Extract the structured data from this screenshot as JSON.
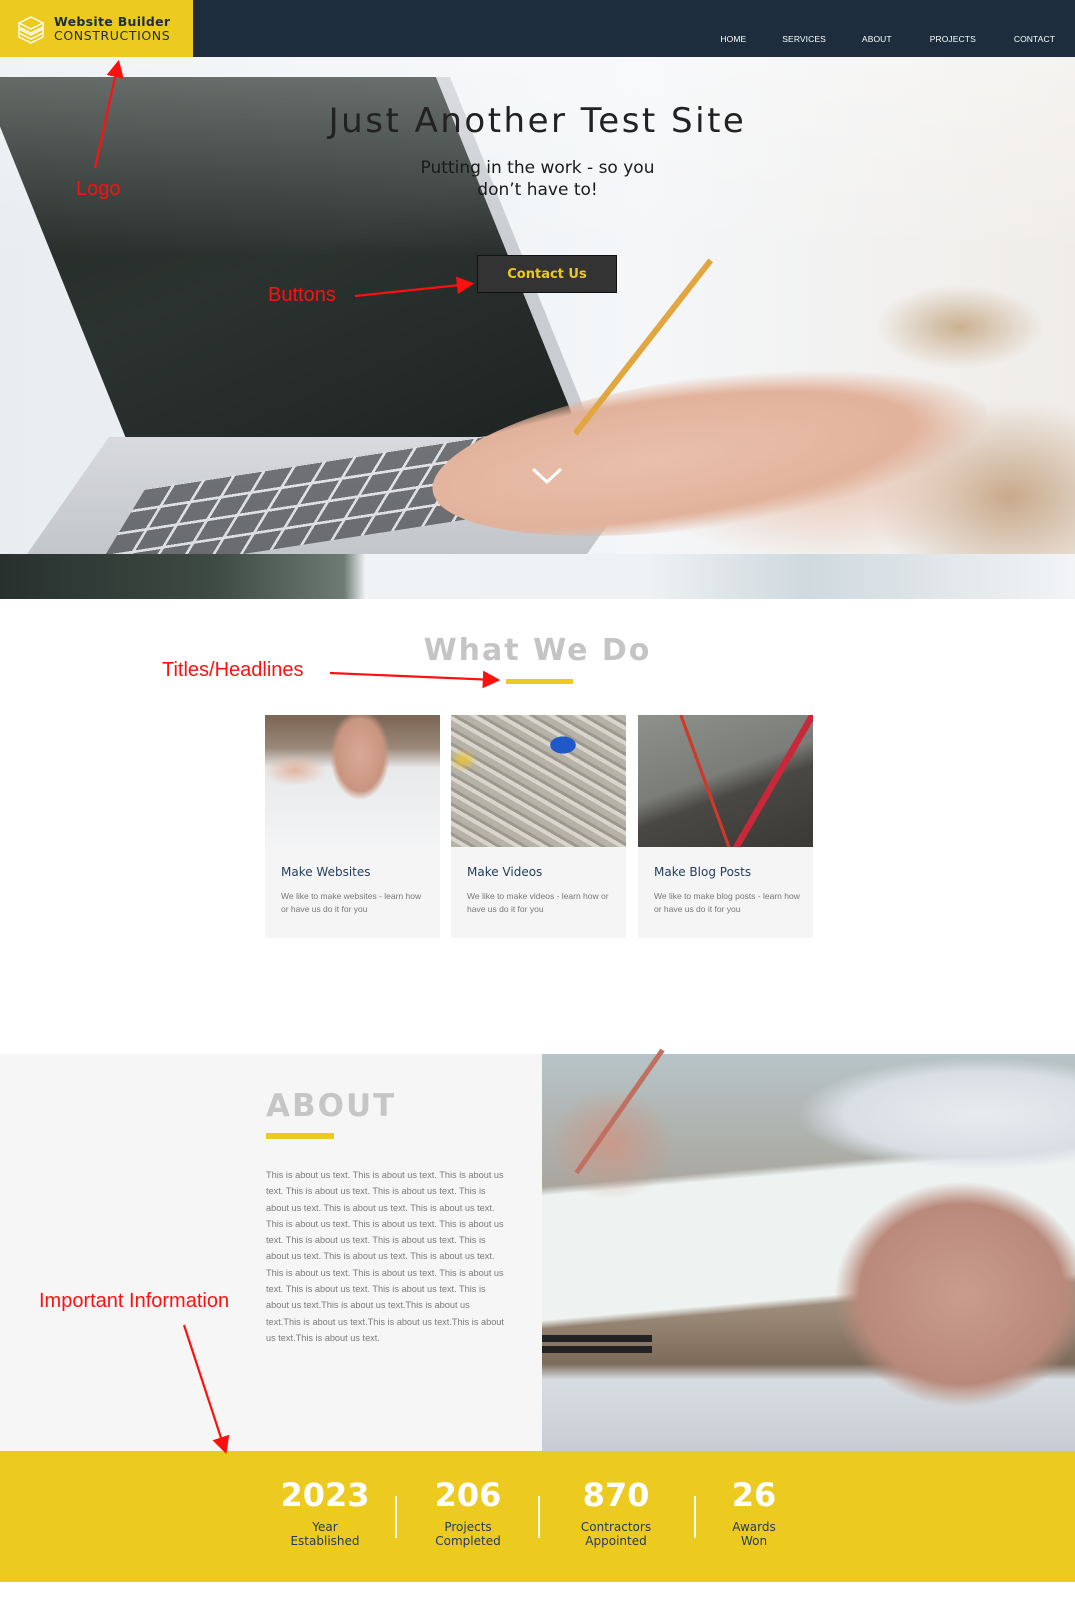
{
  "header": {
    "logo": {
      "line1": "Website Builder",
      "line2": "CONSTRUCTIONS",
      "icon": "layered-cube-icon"
    },
    "nav": [
      {
        "label": "HOME"
      },
      {
        "label": "SERVICES"
      },
      {
        "label": "ABOUT"
      },
      {
        "label": "PROJECTS"
      },
      {
        "label": "CONTACT"
      }
    ]
  },
  "hero": {
    "title": "Just Another Test Site",
    "subtitle_line1": "Putting in the work - so you",
    "subtitle_line2": "don’t have to!",
    "cta_label": "Contact Us",
    "scroll_icon": "chevron-down-icon"
  },
  "annotations": {
    "logo": "Logo",
    "buttons": "Buttons",
    "titles": "Titles/Headlines",
    "important": "Important Information"
  },
  "what_we_do": {
    "title": "What We Do",
    "cards": [
      {
        "title": "Make Websites",
        "description": "We like to make websites - learn how or have us do it for you",
        "image": "blueprint-hands-photo"
      },
      {
        "title": "Make Videos",
        "description": "We like to make videos - learn how or have us do it for you",
        "image": "architecture-model-photo"
      },
      {
        "title": "Make Blog Posts",
        "description": "We like to make blog posts - learn how or have us do it for you",
        "image": "construction-site-aerial-photo"
      }
    ]
  },
  "about": {
    "title": "ABOUT",
    "body": "This is about us text. This is about us text. This is about us text. This is about us text. This is about us text. This is about us text. This is about us text. This is about us text. This is about us text. This is about us text. This is about us text. This is about us text. This is about us text. This is about us text. This is about us text. This is about us text. This is about us text. This is about us text. This is about us text. This is about us text. This is about us text. This is about us text.This is about us text.This is about us text.This is about us text.This is about us text.This is about us text.This is about us text.",
    "image": "planning-meeting-photo"
  },
  "stats": [
    {
      "value": "2023",
      "label_line1": "Year",
      "label_line2": "Established"
    },
    {
      "value": "206",
      "label_line1": "Projects",
      "label_line2": "Completed"
    },
    {
      "value": "870",
      "label_line1": "Contractors",
      "label_line2": "Appointed"
    },
    {
      "value": "26",
      "label_line1": "Awards",
      "label_line2": "Won"
    }
  ],
  "colors": {
    "brand_yellow": "#ecca1f",
    "navy": "#1e2d3d",
    "annotation_red": "#ff1010",
    "heading_gray": "#c4c4c4",
    "card_title_blue": "#1f3c5c"
  }
}
